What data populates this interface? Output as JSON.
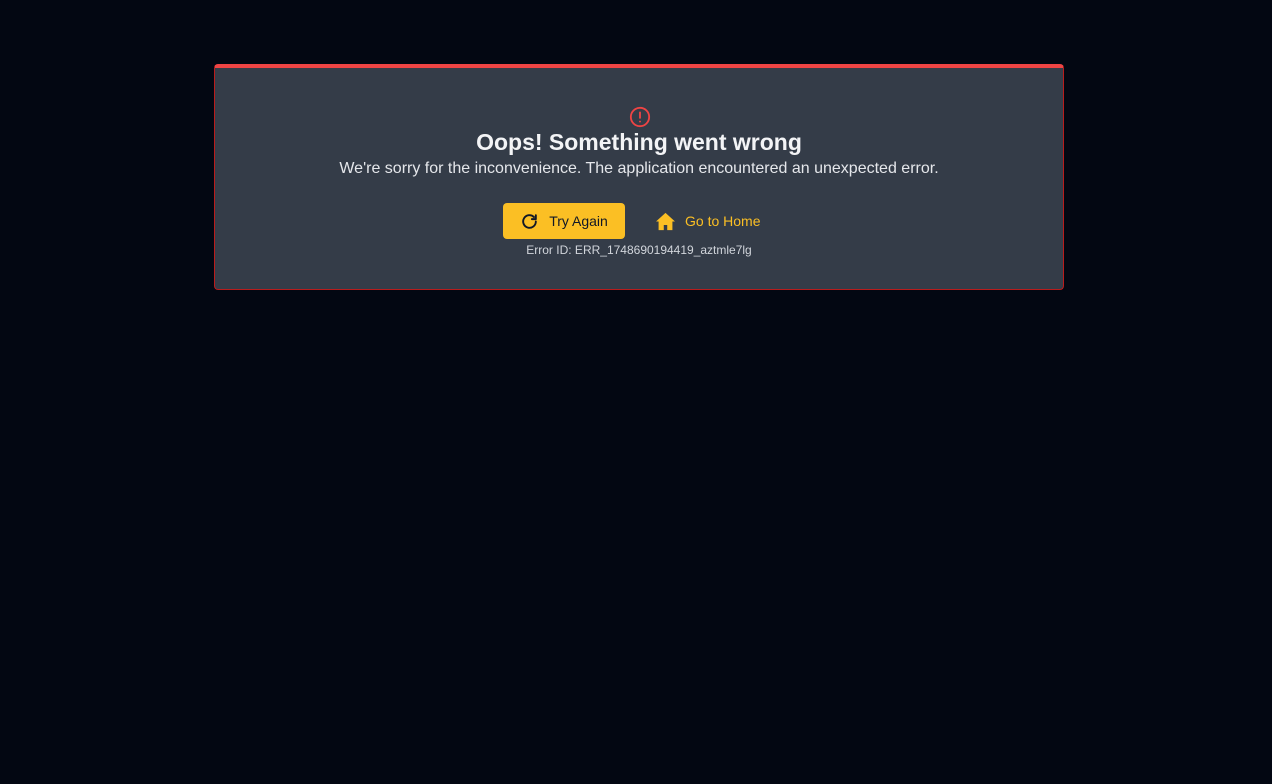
{
  "error": {
    "title": "Oops! Something went wrong",
    "message": "We're sorry for the inconvenience. The application encountered an unexpected error.",
    "error_id_label": "Error ID: ERR_1748690194419_aztmle7lg"
  },
  "actions": {
    "try_again_label": "Try Again",
    "home_label": "Go to Home"
  },
  "icons": {
    "alert": "alert-circle-icon",
    "retry": "refresh-icon",
    "home": "home-icon"
  },
  "colors": {
    "background": "#030712",
    "card": "#343c48",
    "danger": "#ef4444",
    "accent": "#fbbf24"
  }
}
